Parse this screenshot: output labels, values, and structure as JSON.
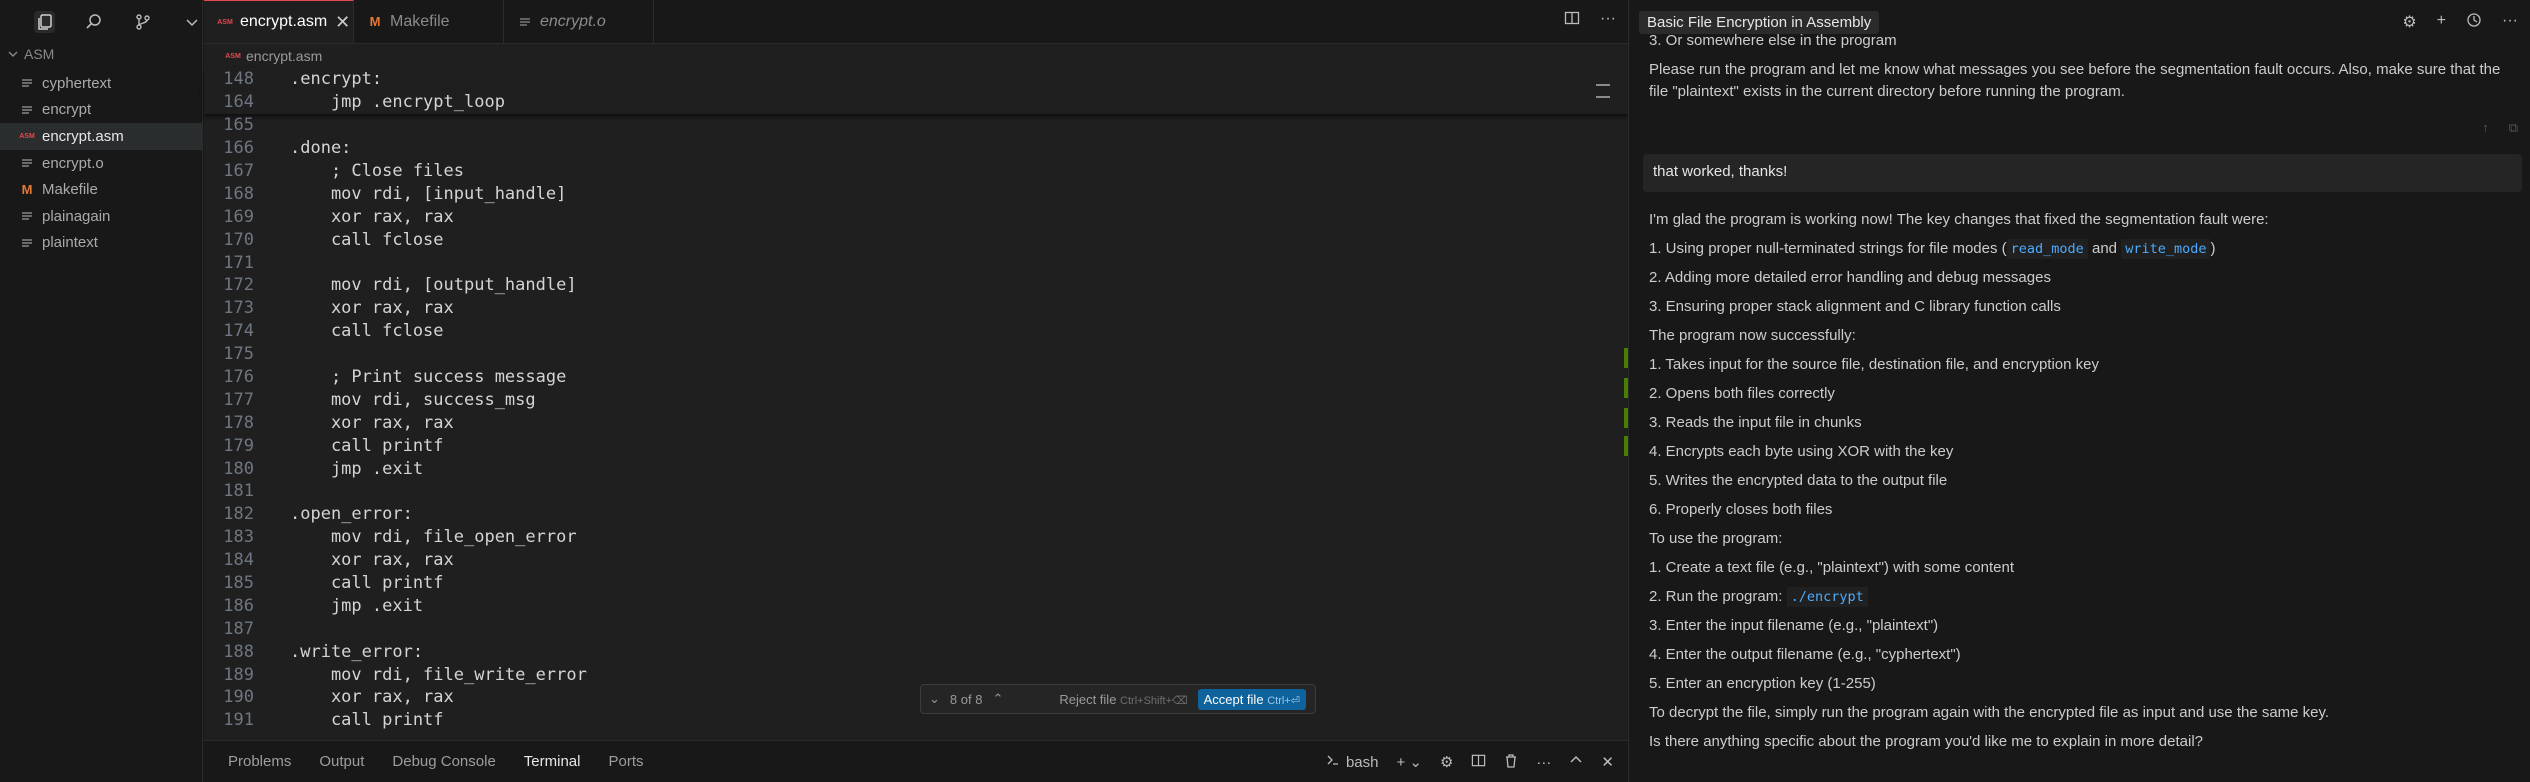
{
  "sidebar": {
    "folder": "ASM",
    "files": [
      {
        "name": "cyphertext",
        "icon": "lines-icon"
      },
      {
        "name": "encrypt",
        "icon": "lines-icon"
      },
      {
        "name": "encrypt.asm",
        "icon": "asm-icon",
        "active": true
      },
      {
        "name": "encrypt.o",
        "icon": "lines-icon"
      },
      {
        "name": "Makefile",
        "icon": "makefile-icon"
      },
      {
        "name": "plainagain",
        "icon": "lines-icon"
      },
      {
        "name": "plaintext",
        "icon": "lines-icon"
      }
    ]
  },
  "tabs": [
    {
      "label": "encrypt.asm",
      "active": true
    },
    {
      "label": "Makefile"
    },
    {
      "label": "encrypt.o"
    }
  ],
  "breadcrumb": "encrypt.asm",
  "code": {
    "sticky": [
      {
        "n": "148",
        "t": ".encrypt:"
      },
      {
        "n": "164",
        "t": "    jmp .encrypt_loop"
      }
    ],
    "lines": [
      {
        "n": "165",
        "t": ""
      },
      {
        "n": "166",
        "t": ".done:"
      },
      {
        "n": "167",
        "t": "    ; Close files"
      },
      {
        "n": "168",
        "t": "    mov rdi, [input_handle]"
      },
      {
        "n": "169",
        "t": "    xor rax, rax"
      },
      {
        "n": "170",
        "t": "    call fclose"
      },
      {
        "n": "171",
        "t": ""
      },
      {
        "n": "172",
        "t": "    mov rdi, [output_handle]"
      },
      {
        "n": "173",
        "t": "    xor rax, rax"
      },
      {
        "n": "174",
        "t": "    call fclose"
      },
      {
        "n": "175",
        "t": ""
      },
      {
        "n": "176",
        "t": "    ; Print success message"
      },
      {
        "n": "177",
        "t": "    mov rdi, success_msg"
      },
      {
        "n": "178",
        "t": "    xor rax, rax"
      },
      {
        "n": "179",
        "t": "    call printf"
      },
      {
        "n": "180",
        "t": "    jmp .exit"
      },
      {
        "n": "181",
        "t": ""
      },
      {
        "n": "182",
        "t": ".open_error:"
      },
      {
        "n": "183",
        "t": "    mov rdi, file_open_error"
      },
      {
        "n": "184",
        "t": "    xor rax, rax"
      },
      {
        "n": "185",
        "t": "    call printf"
      },
      {
        "n": "186",
        "t": "    jmp .exit"
      },
      {
        "n": "187",
        "t": ""
      },
      {
        "n": "188",
        "t": ".write_error:"
      },
      {
        "n": "189",
        "t": "    mov rdi, file_write_error"
      },
      {
        "n": "190",
        "t": "    xor rax, rax"
      },
      {
        "n": "191",
        "t": "    call printf"
      }
    ]
  },
  "review": {
    "counter": "8 of 8",
    "reject_label": "Reject file",
    "reject_kbd": "Ctrl+Shift+⌫",
    "accept_label": "Accept file",
    "accept_kbd": "Ctrl+⏎"
  },
  "panel": {
    "tabs": [
      "Problems",
      "Output",
      "Debug Console",
      "Terminal",
      "Ports"
    ],
    "active": "Terminal",
    "shell": "bash"
  },
  "chat": {
    "title": "Basic File Encryption in Assembly",
    "top_item": "3. Or somewhere else in the program",
    "para1": "Please run the program and let me know what messages you see before the segmentation fault occurs. Also, make sure that the file \"plaintext\" exists in the current directory before running the program.",
    "user_message": "that worked, thanks!",
    "intro": "I'm glad the program is working now! The key changes that fixed the segmentation fault were:",
    "changes": {
      "c1_pre": "1. Using proper null-terminated strings for file modes (",
      "c1_code1": "read_mode",
      "c1_and": " and ",
      "c1_code2": "write_mode",
      "c1_post": ")",
      "c2": "2. Adding more detailed error handling and debug messages",
      "c3": "3. Ensuring proper stack alignment and C library function calls"
    },
    "success_intro": "The program now successfully:",
    "success": [
      "1. Takes input for the source file, destination file, and encryption key",
      "2. Opens both files correctly",
      "3. Reads the input file in chunks",
      "4. Encrypts each byte using XOR with the key",
      "5. Writes the encrypted data to the output file",
      "6. Properly closes both files"
    ],
    "use_intro": "To use the program:",
    "use1": "1. Create a text file (e.g., \"plaintext\") with some content",
    "use2_pre": "2. Run the program: ",
    "use2_code": "./encrypt",
    "use3": "3. Enter the input filename (e.g., \"plaintext\")",
    "use4": "4. Enter the output filename (e.g., \"cyphertext\")",
    "use5": "5. Enter an encryption key (1-255)",
    "decrypt": "To decrypt the file, simply run the program again with the encrypted file as input and use the same key.",
    "closing": "Is there anything specific about the program you'd like me to explain in more detail?"
  }
}
